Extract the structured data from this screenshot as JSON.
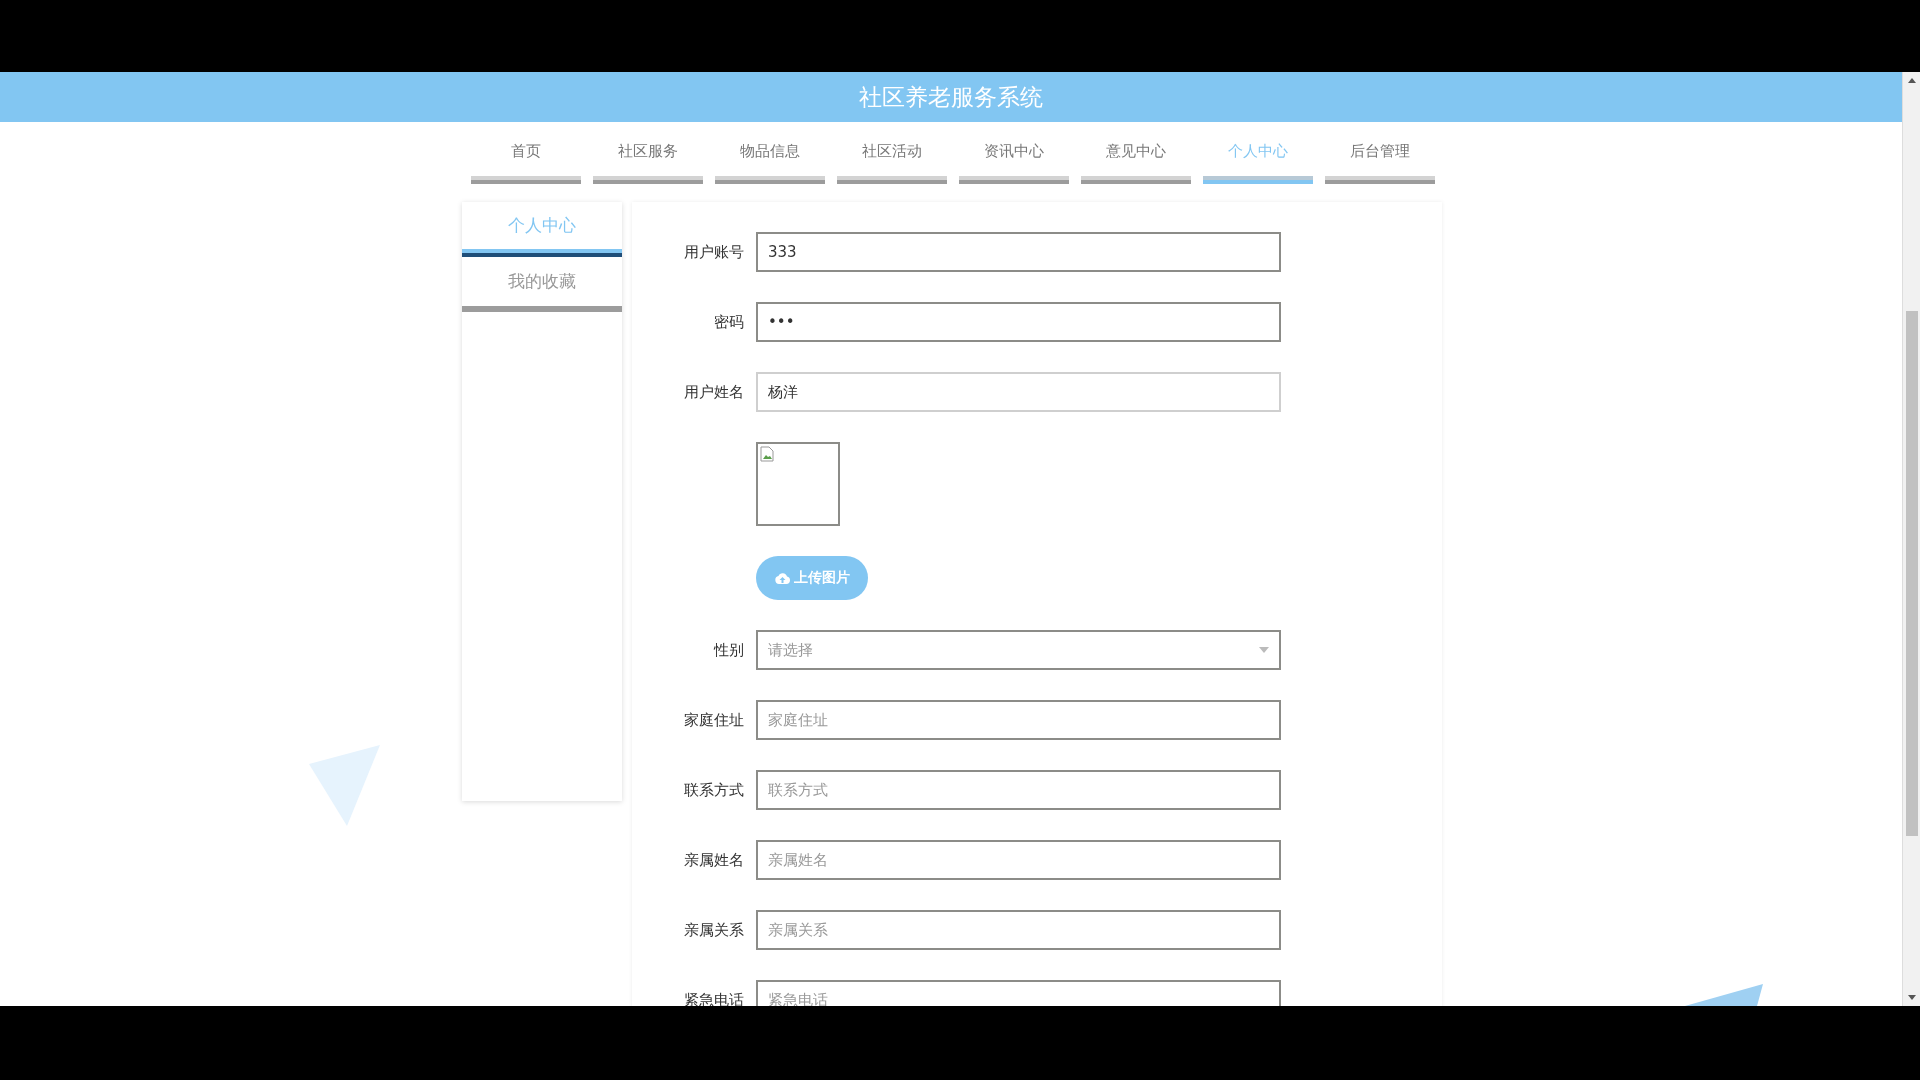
{
  "title": "社区养老服务系统",
  "nav": [
    {
      "label": "首页",
      "selected": false
    },
    {
      "label": "社区服务",
      "selected": false
    },
    {
      "label": "物品信息",
      "selected": false
    },
    {
      "label": "社区活动",
      "selected": false
    },
    {
      "label": "资讯中心",
      "selected": false
    },
    {
      "label": "意见中心",
      "selected": false
    },
    {
      "label": "个人中心",
      "selected": true
    },
    {
      "label": "后台管理",
      "selected": false
    }
  ],
  "sidebar": [
    {
      "label": "个人中心",
      "selected": true
    },
    {
      "label": "我的收藏",
      "selected": false
    }
  ],
  "form": {
    "fields": [
      {
        "kind": "text",
        "label": "用户账号",
        "value": "333",
        "focused": false
      },
      {
        "kind": "text",
        "label": "密码",
        "value": "•••",
        "focused": false
      },
      {
        "kind": "text",
        "label": "用户姓名",
        "value": "杨洋",
        "focused": true
      },
      {
        "kind": "image"
      },
      {
        "kind": "upload",
        "label": "上传图片"
      },
      {
        "kind": "select",
        "label": "性别",
        "placeholder": "请选择"
      },
      {
        "kind": "text",
        "label": "家庭住址",
        "placeholder": "家庭住址",
        "focused": false
      },
      {
        "kind": "text",
        "label": "联系方式",
        "placeholder": "联系方式",
        "focused": false
      },
      {
        "kind": "text",
        "label": "亲属姓名",
        "placeholder": "亲属姓名",
        "focused": false
      },
      {
        "kind": "text",
        "label": "亲属关系",
        "placeholder": "亲属关系",
        "focused": false
      },
      {
        "kind": "text",
        "label": "紧急电话",
        "placeholder": "紧急电话",
        "focused": false
      }
    ]
  }
}
